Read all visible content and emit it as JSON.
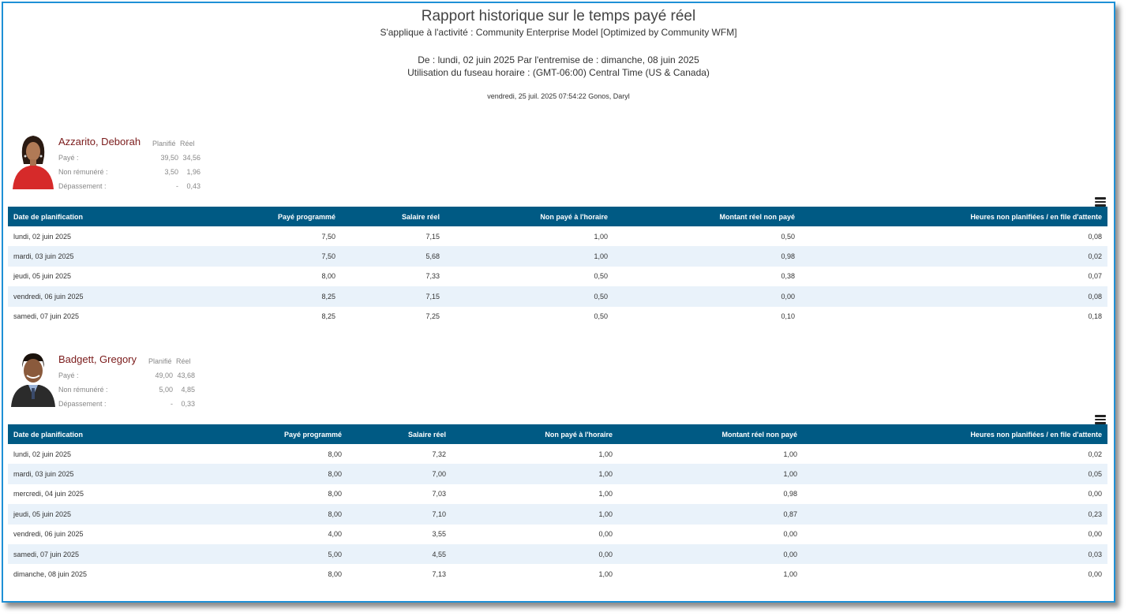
{
  "report": {
    "title": "Rapport historique sur le temps payé réel",
    "subtitle": "S'applique à l'activité : Community Enterprise Model [Optimized by Community WFM]",
    "date_range": "De : lundi, 02 juin 2025 Par l'entremise de : dimanche, 08 juin 2025",
    "timezone": "Utilisation du fuseau horaire : (GMT-06:00) Central Time (US & Canada)",
    "generated": "vendredi, 25 juil. 2025 07:54:22  Gonos, Daryl"
  },
  "columns": [
    "Date de planification",
    "Payé programmé",
    "Salaire réel",
    "Non payé à l'horaire",
    "Montant réel non payé",
    "Heures non planifiées / en file d'attente"
  ],
  "summary_headers": {
    "planned": "Planifié",
    "actual": "Réel"
  },
  "employees": [
    {
      "name": "Azzarito, Deborah",
      "summary": [
        {
          "label": "Payé :",
          "planned": "39,50",
          "actual": "34,56"
        },
        {
          "label": "Non rémunéré :",
          "planned": "3,50",
          "actual": "1,96"
        },
        {
          "label": "Dépassement :",
          "planned": "-",
          "actual": "0,43"
        }
      ],
      "rows": [
        [
          "lundi, 02 juin 2025",
          "7,50",
          "7,15",
          "1,00",
          "0,50",
          "0,08"
        ],
        [
          "mardi, 03 juin 2025",
          "7,50",
          "5,68",
          "1,00",
          "0,98",
          "0,02"
        ],
        [
          "jeudi, 05 juin 2025",
          "8,00",
          "7,33",
          "0,50",
          "0,38",
          "0,07"
        ],
        [
          "vendredi, 06 juin 2025",
          "8,25",
          "7,15",
          "0,50",
          "0,00",
          "0,08"
        ],
        [
          "samedi, 07 juin 2025",
          "8,25",
          "7,25",
          "0,50",
          "0,10",
          "0,18"
        ]
      ]
    },
    {
      "name": "Badgett, Gregory",
      "summary": [
        {
          "label": "Payé :",
          "planned": "49,00",
          "actual": "43,68"
        },
        {
          "label": "Non rémunéré :",
          "planned": "5,00",
          "actual": "4,85"
        },
        {
          "label": "Dépassement :",
          "planned": "-",
          "actual": "0,33"
        }
      ],
      "rows": [
        [
          "lundi, 02 juin 2025",
          "8,00",
          "7,32",
          "1,00",
          "1,00",
          "0,02"
        ],
        [
          "mardi, 03 juin 2025",
          "8,00",
          "7,00",
          "1,00",
          "1,00",
          "0,05"
        ],
        [
          "mercredi, 04 juin 2025",
          "8,00",
          "7,03",
          "1,00",
          "0,98",
          "0,00"
        ],
        [
          "jeudi, 05 juin 2025",
          "8,00",
          "7,10",
          "1,00",
          "0,87",
          "0,23"
        ],
        [
          "vendredi, 06 juin 2025",
          "4,00",
          "3,55",
          "0,00",
          "0,00",
          "0,00"
        ],
        [
          "samedi, 07 juin 2025",
          "5,00",
          "4,55",
          "0,00",
          "0,00",
          "0,03"
        ],
        [
          "dimanche, 08 juin 2025",
          "8,00",
          "7,13",
          "1,00",
          "1,00",
          "0,00"
        ]
      ]
    }
  ],
  "icons": {
    "menu": "hamburger-menu-icon",
    "photo": "person-photo-icon"
  },
  "colors": {
    "header_bg": "#005a84",
    "alt_row": "#e9f2fa",
    "name": "#7a1a1a",
    "frame": "#1e90d6"
  }
}
